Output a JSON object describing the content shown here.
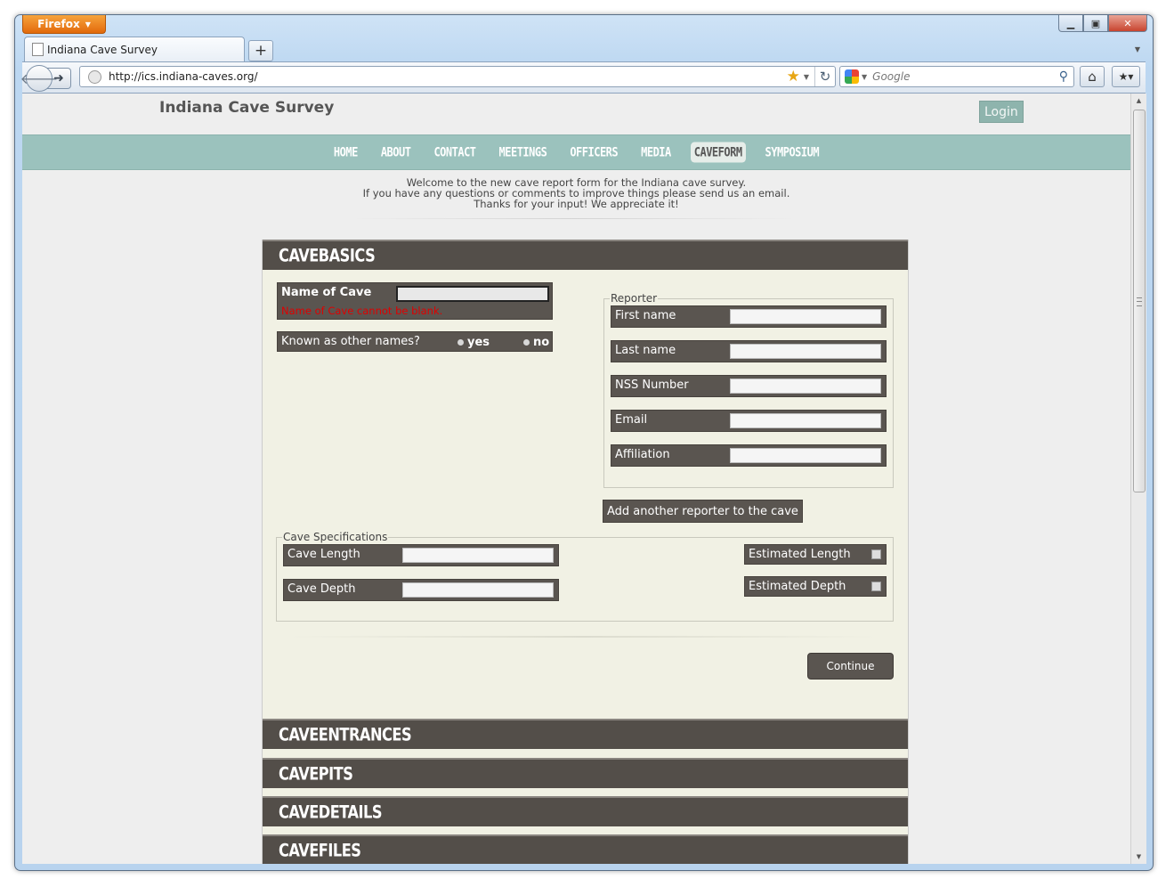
{
  "browser": {
    "app_button": "Firefox",
    "tab_title": "Indiana Cave Survey",
    "url": "http://ics.indiana-caves.org/",
    "search_engine": "Google"
  },
  "site": {
    "title": "Indiana Cave Survey",
    "login_label": "Login",
    "nav": [
      "HOME",
      "ABOUT",
      "CONTACT",
      "MEETINGS",
      "OFFICERS",
      "MEDIA",
      "CAVEFORM",
      "SYMPOSIUM"
    ],
    "active_nav": "CAVEFORM",
    "welcome_lines": [
      "Welcome to the new cave report form for the Indiana cave survey.",
      "If you have any questions or comments to improve things please send us an email.",
      "Thanks for your input! We appreciate it!"
    ]
  },
  "form": {
    "sections": [
      "CAVEBASICS",
      "CAVEENTRANCES",
      "CAVEPITS",
      "CAVEDETAILS",
      "CAVEFILES"
    ],
    "name_of_cave": {
      "label": "Name of Cave",
      "value": "",
      "error": "Name of Cave cannot be blank."
    },
    "other_names": {
      "label": "Known as other names?",
      "yes": "yes",
      "no": "no"
    },
    "reporter": {
      "legend": "Reporter",
      "fields": [
        "First name",
        "Last name",
        "NSS Number",
        "Email",
        "Affiliation"
      ],
      "add_button": "Add another reporter to the cave"
    },
    "specs": {
      "legend": "Cave Specifications",
      "length_label": "Cave Length",
      "depth_label": "Cave Depth",
      "est_length": "Estimated Length",
      "est_depth": "Estimated Depth"
    },
    "continue_label": "Continue"
  },
  "colors": {
    "nav_bar": "#9bc2bd",
    "section_header": "#534e49",
    "panel_bg": "#f1f1e4",
    "error": "#e00000"
  }
}
